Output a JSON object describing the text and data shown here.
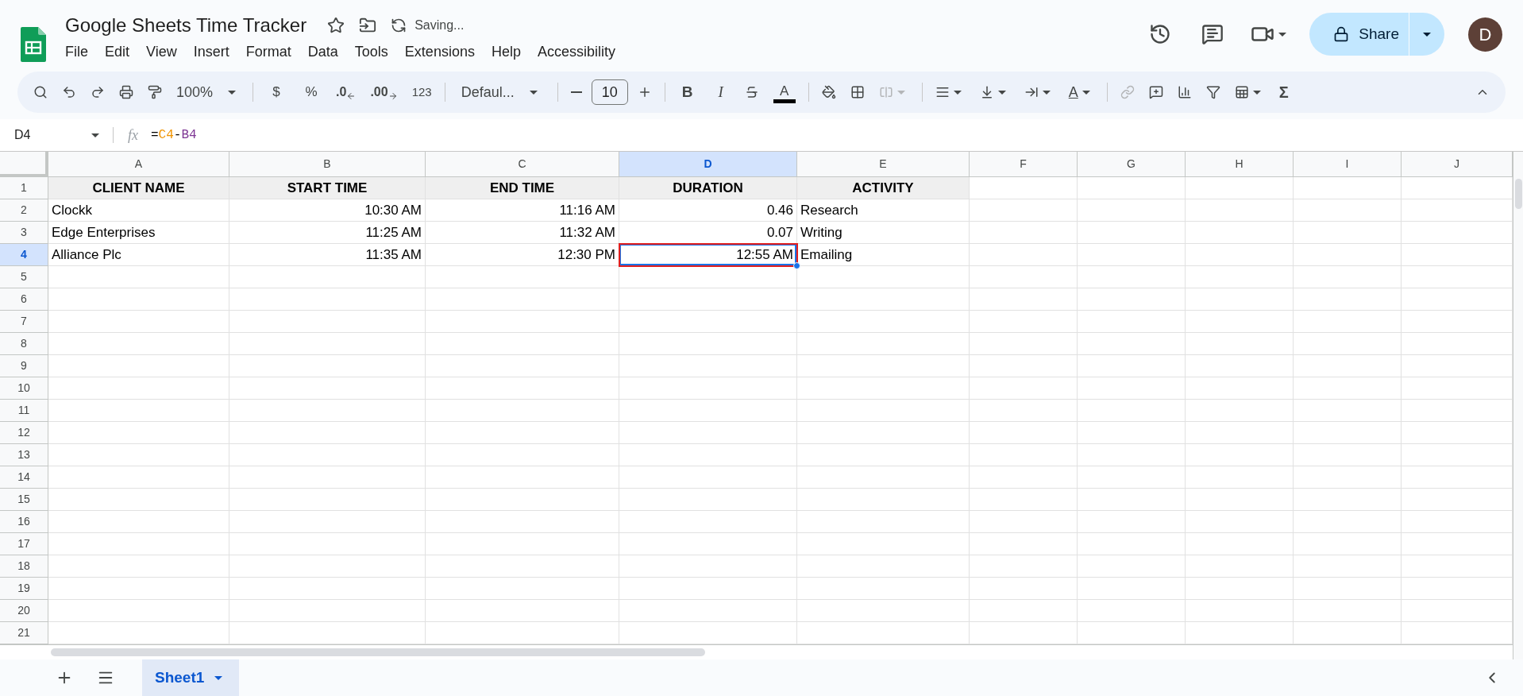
{
  "document": {
    "title": "Google Sheets Time Tracker",
    "status": "Saving..."
  },
  "menus": [
    "File",
    "Edit",
    "View",
    "Insert",
    "Format",
    "Data",
    "Tools",
    "Extensions",
    "Help",
    "Accessibility"
  ],
  "share": {
    "label": "Share"
  },
  "avatar": {
    "initial": "D"
  },
  "toolbar": {
    "zoom": "100%",
    "currency": "$",
    "percent": "%",
    "decrease_decimals": ".0",
    "increase_decimals": ".00",
    "more_formats": "123",
    "font": "Defaul...",
    "font_size": "10",
    "bold": "B",
    "italic": "I",
    "text_color": "A",
    "text_rotation": "A",
    "functions": "Σ"
  },
  "formula_bar": {
    "cell_ref": "D4",
    "fx_label": "fx",
    "tokens": [
      {
        "text": "=",
        "color": "#000000"
      },
      {
        "text": "C4",
        "color": "#f09300"
      },
      {
        "text": "-",
        "color": "#000000"
      },
      {
        "text": "B4",
        "color": "#7e3794"
      }
    ]
  },
  "columns": [
    {
      "label": "A",
      "selected": false
    },
    {
      "label": "B",
      "selected": false
    },
    {
      "label": "C",
      "selected": false
    },
    {
      "label": "D",
      "selected": true
    },
    {
      "label": "E",
      "selected": false
    },
    {
      "label": "F",
      "selected": false
    },
    {
      "label": "G",
      "selected": false
    },
    {
      "label": "H",
      "selected": false
    },
    {
      "label": "I",
      "selected": false
    },
    {
      "label": "J",
      "selected": false
    }
  ],
  "rows": [
    {
      "number": "1",
      "selected": false,
      "cells": [
        {
          "text": "CLIENT NAME",
          "kind": "header",
          "selected": false
        },
        {
          "text": "START TIME",
          "kind": "header",
          "selected": false
        },
        {
          "text": "END TIME",
          "kind": "header",
          "selected": false
        },
        {
          "text": "DURATION",
          "kind": "header",
          "selected": false
        },
        {
          "text": "ACTIVITY",
          "kind": "header",
          "selected": false
        }
      ]
    },
    {
      "number": "2",
      "selected": false,
      "cells": [
        {
          "text": "Clockk",
          "kind": "text",
          "selected": false
        },
        {
          "text": "10:30 AM",
          "kind": "number",
          "selected": false
        },
        {
          "text": "11:16 AM",
          "kind": "number",
          "selected": false
        },
        {
          "text": "0.46",
          "kind": "number",
          "selected": false
        },
        {
          "text": "Research",
          "kind": "text",
          "selected": false
        }
      ]
    },
    {
      "number": "3",
      "selected": false,
      "cells": [
        {
          "text": "Edge Enterprises",
          "kind": "text",
          "selected": false
        },
        {
          "text": "11:25 AM",
          "kind": "number",
          "selected": false
        },
        {
          "text": "11:32 AM",
          "kind": "number",
          "selected": false
        },
        {
          "text": "0.07",
          "kind": "number",
          "selected": false
        },
        {
          "text": "Writing",
          "kind": "text",
          "selected": false
        }
      ]
    },
    {
      "number": "4",
      "selected": true,
      "cells": [
        {
          "text": "Alliance Plc",
          "kind": "text",
          "selected": false
        },
        {
          "text": "11:35 AM",
          "kind": "number",
          "selected": false
        },
        {
          "text": "12:30 PM",
          "kind": "number",
          "selected": false
        },
        {
          "text": "12:55 AM",
          "kind": "number",
          "selected": true
        },
        {
          "text": "Emailing",
          "kind": "text",
          "selected": false
        }
      ]
    },
    {
      "number": "5",
      "selected": false
    },
    {
      "number": "6",
      "selected": false
    },
    {
      "number": "7",
      "selected": false
    },
    {
      "number": "8",
      "selected": false
    },
    {
      "number": "9",
      "selected": false
    },
    {
      "number": "10",
      "selected": false
    },
    {
      "number": "11",
      "selected": false
    },
    {
      "number": "12",
      "selected": false
    },
    {
      "number": "13",
      "selected": false
    },
    {
      "number": "14",
      "selected": false
    },
    {
      "number": "15",
      "selected": false
    },
    {
      "number": "16",
      "selected": false
    },
    {
      "number": "17",
      "selected": false
    },
    {
      "number": "18",
      "selected": false
    },
    {
      "number": "19",
      "selected": false
    },
    {
      "number": "20",
      "selected": false
    },
    {
      "number": "21",
      "selected": false
    }
  ],
  "sheets": [
    {
      "label": "Sheet1",
      "selected": true
    }
  ]
}
